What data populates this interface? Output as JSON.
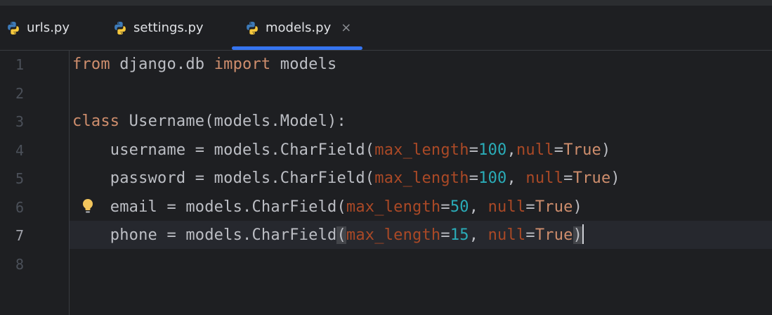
{
  "tabs": [
    {
      "label": "urls.py",
      "icon": "python-icon",
      "active": false
    },
    {
      "label": "settings.py",
      "icon": "python-icon",
      "active": false
    },
    {
      "label": "models.py",
      "icon": "python-icon",
      "active": true,
      "close": "×"
    }
  ],
  "editor": {
    "current_line": 7,
    "line_numbers": [
      "1",
      "2",
      "3",
      "4",
      "5",
      "6",
      "7",
      "8"
    ],
    "lines": [
      {
        "tokens": [
          {
            "text": "from",
            "kind": "kw"
          },
          {
            "text": " django.db ",
            "kind": "plain"
          },
          {
            "text": "import",
            "kind": "kw"
          },
          {
            "text": " models",
            "kind": "plain"
          }
        ]
      },
      {
        "tokens": []
      },
      {
        "tokens": [
          {
            "text": "class",
            "kind": "kw"
          },
          {
            "text": " Username(models.Model):",
            "kind": "plain"
          }
        ]
      },
      {
        "tokens": [
          {
            "text": "    username = models.CharField(",
            "kind": "plain"
          },
          {
            "text": "max_length",
            "kind": "param"
          },
          {
            "text": "=",
            "kind": "plain"
          },
          {
            "text": "100",
            "kind": "num"
          },
          {
            "text": ",",
            "kind": "plain"
          },
          {
            "text": "null",
            "kind": "param"
          },
          {
            "text": "=",
            "kind": "plain"
          },
          {
            "text": "True",
            "kind": "kw"
          },
          {
            "text": ")",
            "kind": "plain"
          }
        ]
      },
      {
        "tokens": [
          {
            "text": "    password = models.CharField(",
            "kind": "plain"
          },
          {
            "text": "max_length",
            "kind": "param"
          },
          {
            "text": "=",
            "kind": "plain"
          },
          {
            "text": "100",
            "kind": "num"
          },
          {
            "text": ", ",
            "kind": "plain"
          },
          {
            "text": "null",
            "kind": "param"
          },
          {
            "text": "=",
            "kind": "plain"
          },
          {
            "text": "True",
            "kind": "kw"
          },
          {
            "text": ")",
            "kind": "plain"
          }
        ]
      },
      {
        "tokens": [
          {
            "text": "    email = models.CharField(",
            "kind": "plain"
          },
          {
            "text": "max_length",
            "kind": "param"
          },
          {
            "text": "=",
            "kind": "plain"
          },
          {
            "text": "50",
            "kind": "num"
          },
          {
            "text": ", ",
            "kind": "plain"
          },
          {
            "text": "null",
            "kind": "param"
          },
          {
            "text": "=",
            "kind": "plain"
          },
          {
            "text": "True",
            "kind": "kw"
          },
          {
            "text": ")",
            "kind": "plain"
          }
        ]
      },
      {
        "tokens": [
          {
            "text": "    phone = models.CharField",
            "kind": "plain"
          },
          {
            "text": "(",
            "kind": "paren-hl"
          },
          {
            "text": "max_length",
            "kind": "param"
          },
          {
            "text": "=",
            "kind": "plain"
          },
          {
            "text": "15",
            "kind": "num"
          },
          {
            "text": ", ",
            "kind": "plain"
          },
          {
            "text": "null",
            "kind": "param"
          },
          {
            "text": "=",
            "kind": "plain"
          },
          {
            "text": "True",
            "kind": "kw"
          },
          {
            "text": ")",
            "kind": "paren-hl"
          }
        ]
      },
      {
        "tokens": []
      }
    ]
  },
  "colors": {
    "background": "#1e1f22",
    "keyword": "#cf8e6d",
    "parameter": "#aa4926",
    "number": "#2aacb8",
    "plain": "#bcbec4",
    "tab_underline": "#3574f0",
    "lightbulb": "#f2c55c"
  },
  "gutter_icon": "lightbulb-icon"
}
